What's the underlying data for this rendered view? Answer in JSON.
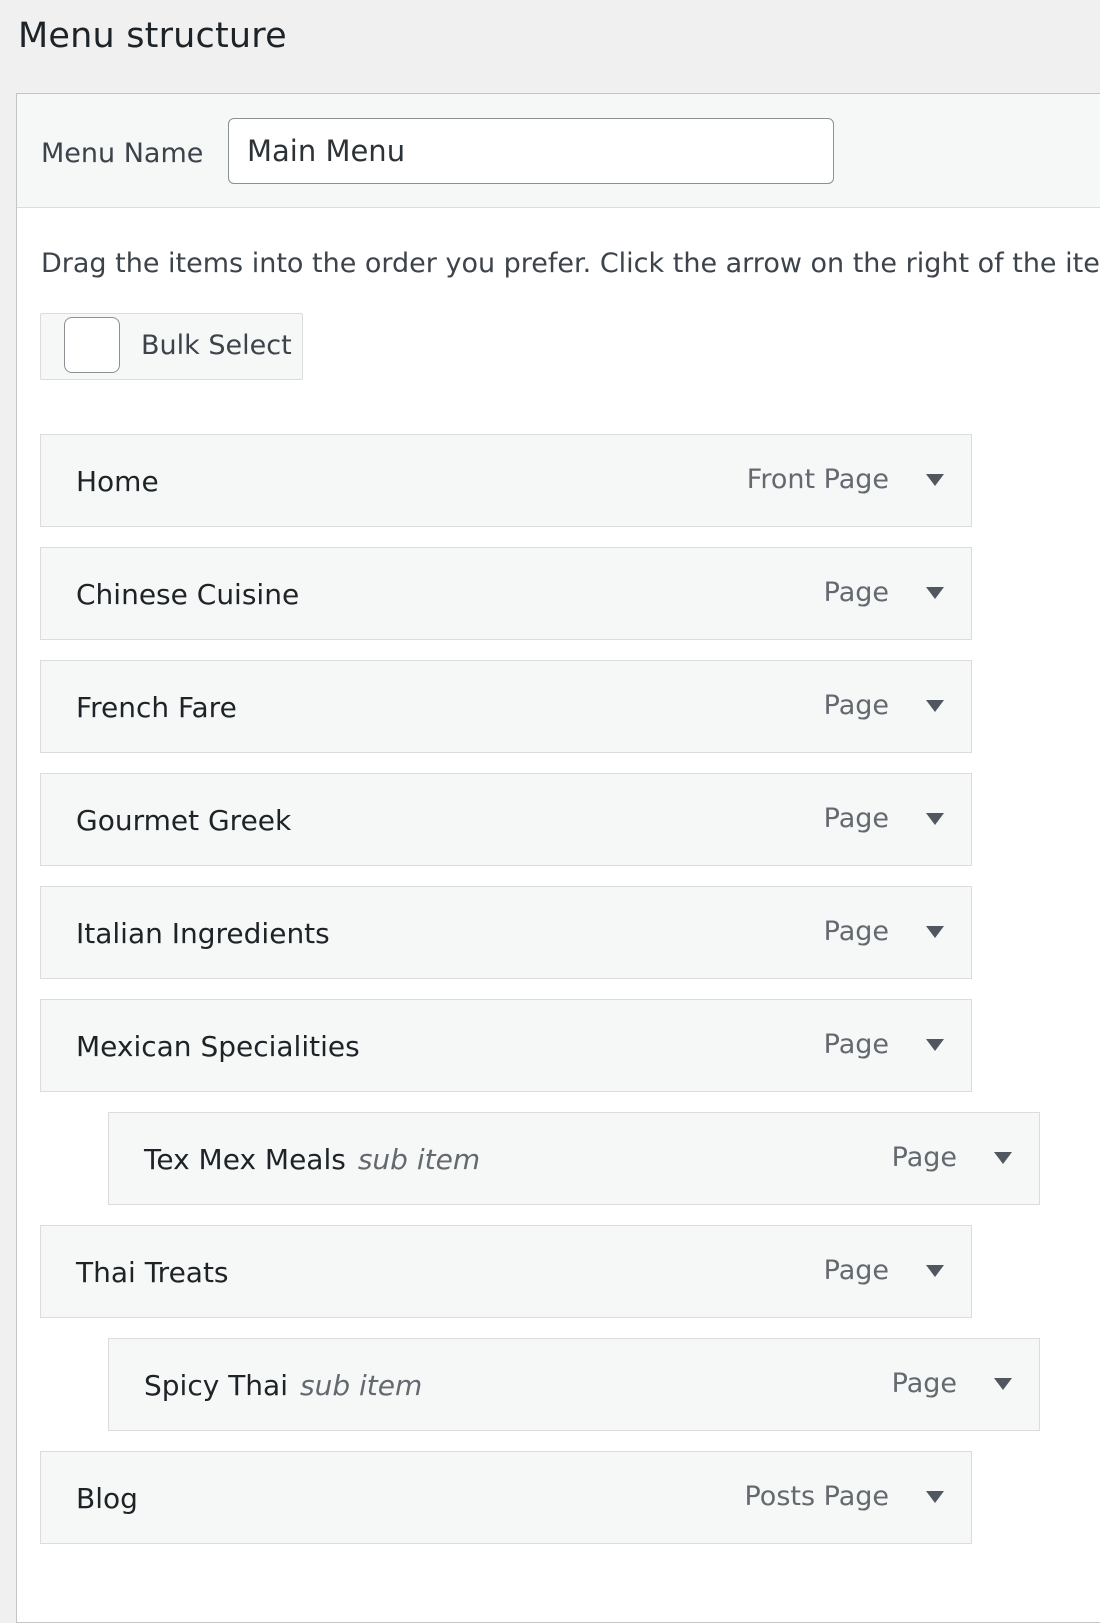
{
  "page": {
    "title": "Menu structure"
  },
  "menu_name": {
    "label": "Menu Name",
    "value": "Main Menu"
  },
  "instructions": "Drag the items into the order you prefer. Click the arrow on the right of the item",
  "bulk_select": {
    "label": "Bulk Select",
    "checked": false
  },
  "items": [
    {
      "title": "Home",
      "type": "Front Page",
      "sub_label": "",
      "depth": 0
    },
    {
      "title": "Chinese Cuisine",
      "type": "Page",
      "sub_label": "",
      "depth": 0
    },
    {
      "title": "French Fare",
      "type": "Page",
      "sub_label": "",
      "depth": 0
    },
    {
      "title": "Gourmet Greek",
      "type": "Page",
      "sub_label": "",
      "depth": 0
    },
    {
      "title": "Italian Ingredients",
      "type": "Page",
      "sub_label": "",
      "depth": 0
    },
    {
      "title": "Mexican Specialities",
      "type": "Page",
      "sub_label": "",
      "depth": 0
    },
    {
      "title": "Tex Mex Meals",
      "type": "Page",
      "sub_label": "sub item",
      "depth": 1
    },
    {
      "title": "Thai Treats",
      "type": "Page",
      "sub_label": "",
      "depth": 0
    },
    {
      "title": "Spicy Thai",
      "type": "Page",
      "sub_label": "sub item",
      "depth": 1
    },
    {
      "title": "Blog",
      "type": "Posts Page",
      "sub_label": "",
      "depth": 0
    }
  ],
  "icons": {
    "item_toggle": "triangle-down-icon"
  },
  "colors": {
    "background": "#f0f0f1",
    "item_background": "#f6f7f7",
    "border": "#dcdcde",
    "text": "#1d2327",
    "muted_text": "#646970"
  }
}
